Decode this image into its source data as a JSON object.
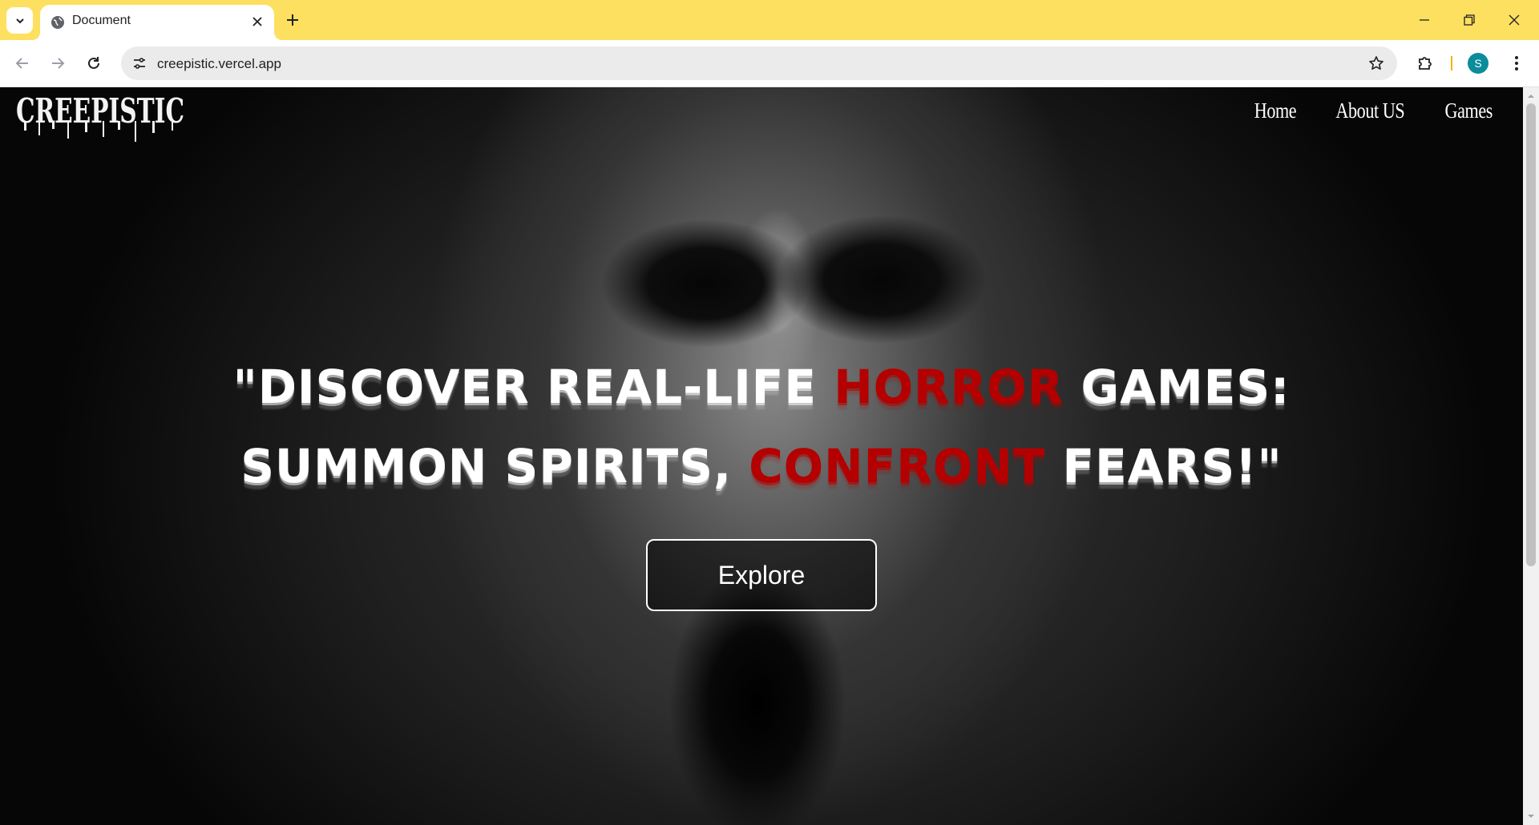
{
  "browser": {
    "tab": {
      "title": "Document",
      "favicon": "globe-icon"
    },
    "url": "creepistic.vercel.app",
    "profile_initial": "S",
    "colors": {
      "tabstrip": "#fde05f",
      "avatar": "#0a8c9a"
    }
  },
  "site": {
    "logo_text": "CREEPISTIC",
    "nav": [
      "Home",
      "About US",
      "Games"
    ],
    "headline": {
      "part1": "\"DISCOVER REAL-LIFE ",
      "accent1": "HORROR",
      "part2": " GAMES:",
      "part3": "SUMMON SPIRITS, ",
      "accent2": "CONFRONT",
      "part4": " FEARS!\""
    },
    "cta_label": "Explore",
    "colors": {
      "accent": "#b40000",
      "text": "#ffffff"
    }
  }
}
